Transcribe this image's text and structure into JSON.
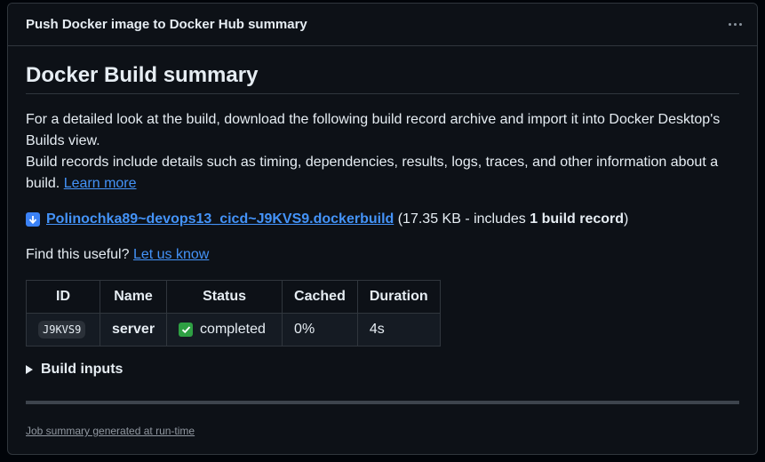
{
  "card": {
    "title": "Push Docker image to Docker Hub summary",
    "menu_icon": "kebab-horizontal-icon"
  },
  "summary": {
    "heading": "Docker Build summary",
    "intro_line1": "For a detailed look at the build, download the following build record archive and import it into Docker Desktop's Builds view.",
    "intro_line2": "Build records include details such as timing, dependencies, results, logs, traces, and other information about a build. ",
    "learn_more": "Learn more",
    "download_icon": "arrow-down-icon",
    "file_name": "Polinochka89~devops13_cicd~J9KVS9.dockerbuild",
    "file_info_prefix": " (17.35 KB - includes ",
    "file_info_bold": "1 build record",
    "file_info_suffix": ")",
    "find_useful": "Find this useful? ",
    "let_us_know": "Let us know"
  },
  "table": {
    "headers": [
      "ID",
      "Name",
      "Status",
      "Cached",
      "Duration"
    ],
    "rows": [
      {
        "id": "J9KVS9",
        "name": "server",
        "status_icon": "white-check-mark-icon",
        "status": "completed",
        "cached": "0%",
        "duration": "4s"
      }
    ]
  },
  "build_inputs": {
    "label": "Build inputs"
  },
  "footer": {
    "text": "Job summary generated at run-time"
  },
  "colors": {
    "background": "#0d1117",
    "link": "#4493f8",
    "border": "#30363d",
    "success": "#2ea043"
  }
}
